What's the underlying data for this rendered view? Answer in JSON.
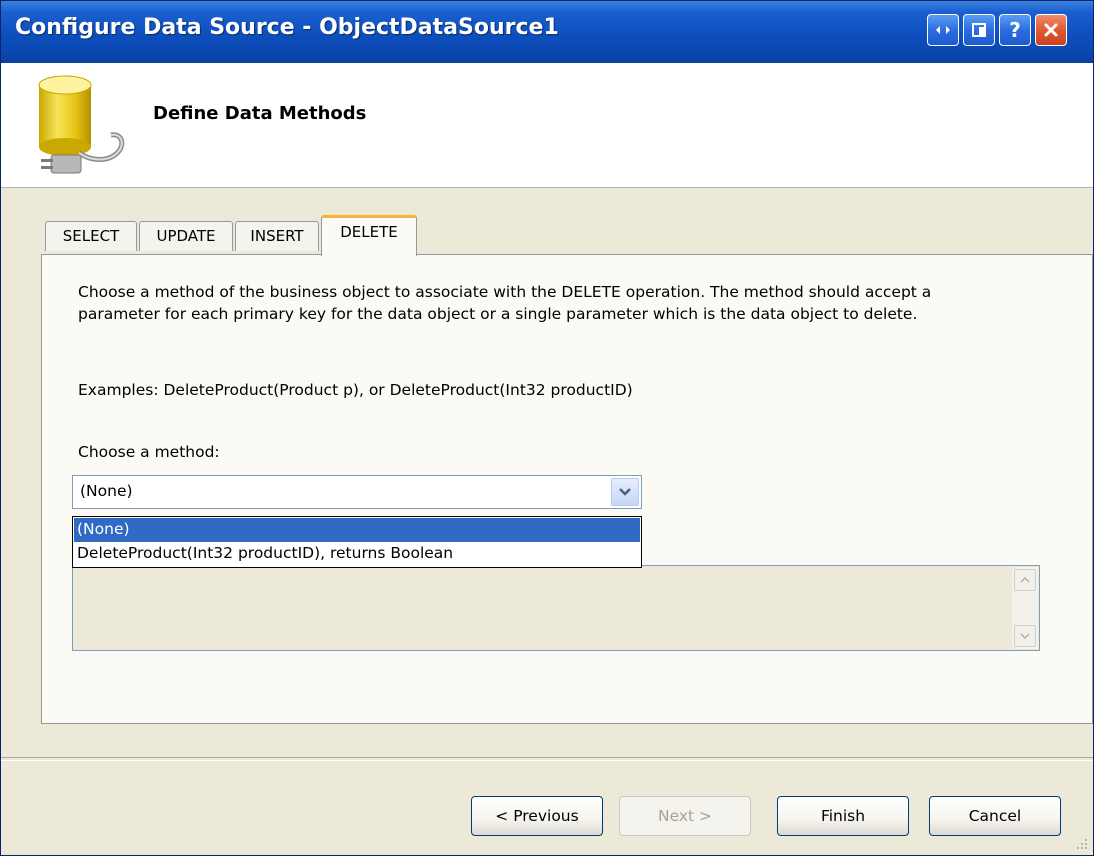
{
  "window": {
    "title": "Configure Data Source - ObjectDataSource1",
    "buttons": [
      "restore-icon",
      "maximize-icon",
      "help-icon",
      "close-icon"
    ]
  },
  "header": {
    "title": "Define Data Methods",
    "icon": "database-plug-icon"
  },
  "tabs": [
    {
      "label": "SELECT",
      "active": false
    },
    {
      "label": "UPDATE",
      "active": false
    },
    {
      "label": "INSERT",
      "active": false
    },
    {
      "label": "DELETE",
      "active": true
    }
  ],
  "panel": {
    "description": "Choose a method of the business object to associate with the DELETE operation. The method should accept a parameter for each primary key for the data object or a single parameter which is the data object to delete.",
    "examples": "Examples: DeleteProduct(Product p), or DeleteProduct(Int32 productID)",
    "choose_label": "Choose a method:",
    "combo_value": "(None)",
    "dropdown_options": [
      "(None)",
      "DeleteProduct(Int32 productID), returns Boolean"
    ],
    "selected_option": "(None)"
  },
  "buttons": {
    "previous": "< Previous",
    "next": "Next >",
    "finish": "Finish",
    "cancel": "Cancel"
  },
  "colors": {
    "titlebar": "#0a47b0",
    "selection": "#316ac5",
    "active_tab_accent": "#f8b13b",
    "dialog_bg": "#ece9d8"
  }
}
